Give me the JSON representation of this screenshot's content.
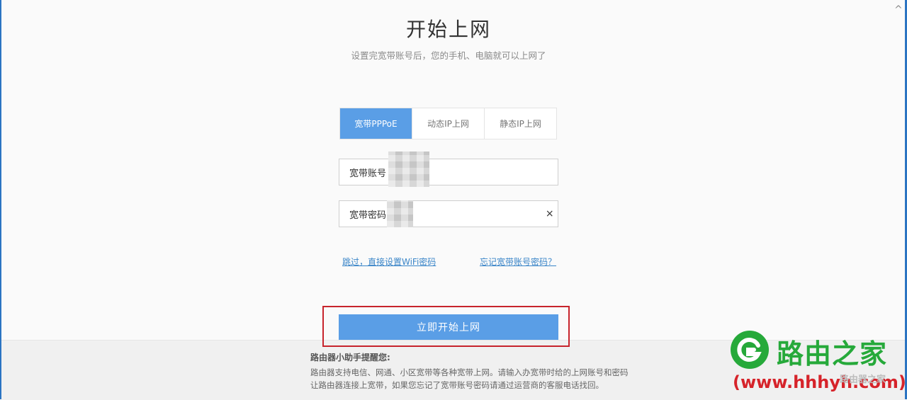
{
  "page": {
    "title": "开始上网",
    "subtitle": "设置完宽带账号后，您的手机、电脑就可以上网了",
    "collapse_glyph": "^"
  },
  "tabs": [
    {
      "label": "宽带PPPoE",
      "active": true
    },
    {
      "label": "动态IP上网",
      "active": false
    },
    {
      "label": "静态IP上网",
      "active": false
    }
  ],
  "form": {
    "account_label": "宽带账号",
    "password_label": "宽带密码",
    "clear_glyph": "×"
  },
  "links": {
    "skip": "跳过，直接设置WiFi密码",
    "forgot": "忘记宽带账号密码？"
  },
  "primary_button": "立即开始上网",
  "footer": {
    "tip_title": "路由器小助手提醒您:",
    "line1": "路由器支持电信、网通、小区宽带等各种宽带上网。请输入办宽带时给的上网账号和密码",
    "line2": "让路由器连接上宽带，如果您忘记了宽带账号密码请通过运营商的客服电话找回。"
  },
  "watermark": {
    "name": "路由之家",
    "url": "(www.hhhyh.com)",
    "ghost": "路由器之家"
  },
  "colors": {
    "accent": "#5a9ee6",
    "link": "#3a85c8",
    "highlight_border": "#c7242c",
    "watermark_green": "#26a93a",
    "watermark_red": "#d6232a"
  }
}
